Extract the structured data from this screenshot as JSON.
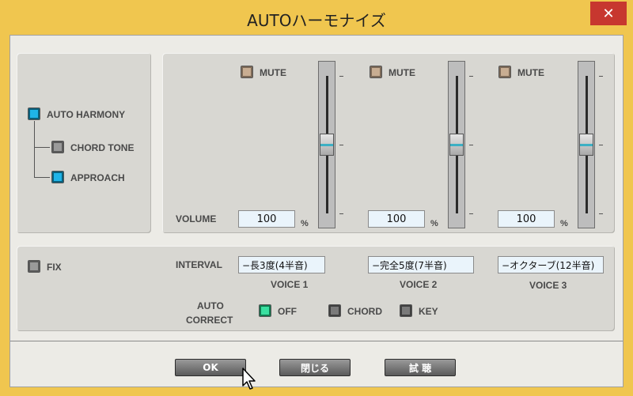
{
  "window": {
    "title": "AUTOハーモナイズ",
    "close_glyph": "✕"
  },
  "left": {
    "auto_harmony": "AUTO HARMONY",
    "chord_tone": "CHORD TONE",
    "approach": "APPROACH",
    "fix": "FIX"
  },
  "voices": [
    {
      "mute": "MUTE",
      "volume": "100",
      "unit": "%",
      "interval": "−長3度(4半音)",
      "label": "VOICE 1",
      "level": 0.5
    },
    {
      "mute": "MUTE",
      "volume": "100",
      "unit": "%",
      "interval": "−完全5度(7半音)",
      "label": "VOICE 2",
      "level": 0.5
    },
    {
      "mute": "MUTE",
      "volume": "100",
      "unit": "%",
      "interval": "−オクターブ(12半音)",
      "label": "VOICE 3",
      "level": 0.5
    }
  ],
  "labels": {
    "volume": "VOLUME",
    "interval": "INTERVAL",
    "auto": "AUTO",
    "correct": "CORRECT"
  },
  "auto_correct": {
    "off": "OFF",
    "chord": "CHORD",
    "key": "KEY"
  },
  "buttons": {
    "ok": "OK",
    "close": "閉じる",
    "trial": "試 聴"
  }
}
